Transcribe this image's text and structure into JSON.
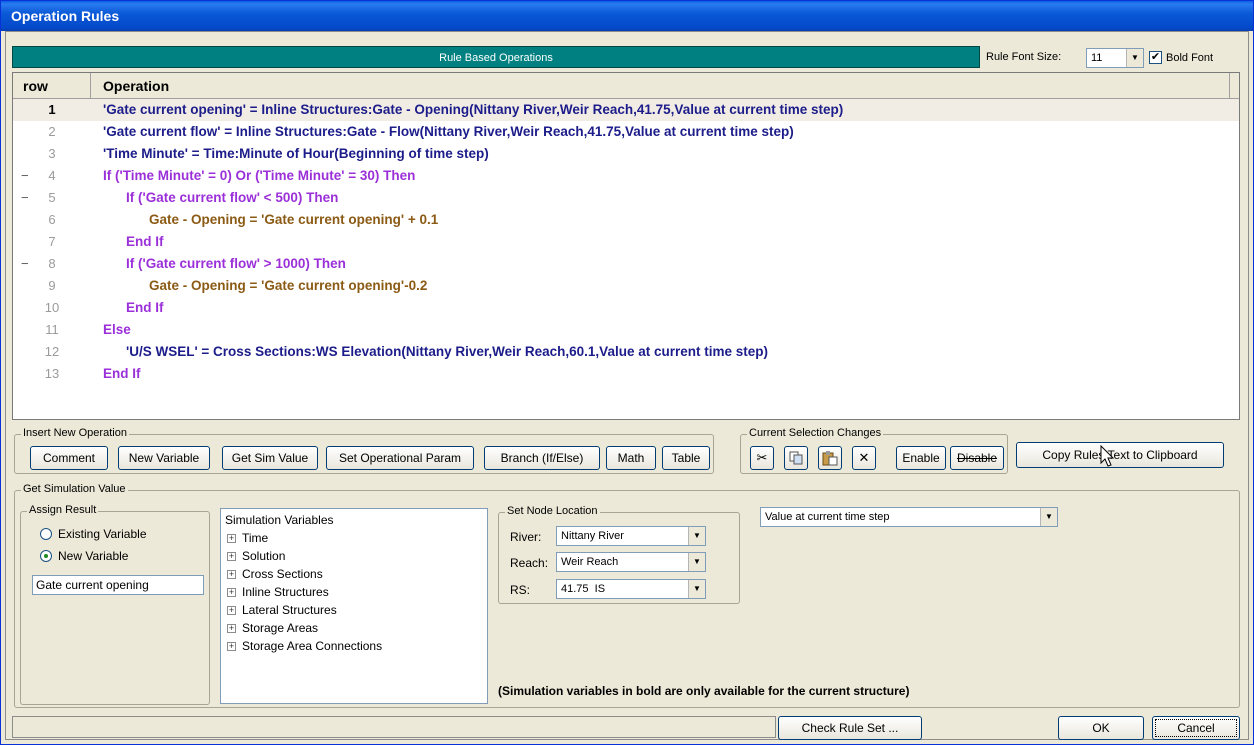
{
  "window": {
    "title": "Operation Rules"
  },
  "header": {
    "band_label": "Rule Based Operations",
    "font_size_label": "Rule Font Size:",
    "font_size_value": "11",
    "bold_font_label": "Bold Font",
    "bold_font_checked": true
  },
  "grid": {
    "col_row": "row",
    "col_op": "Operation",
    "rows": [
      {
        "num": "1",
        "indent": 0,
        "collapse": "",
        "color": "navy",
        "text": "'Gate current opening' = Inline Structures:Gate - Opening(Nittany River,Weir Reach,41.75,Value at current time step)"
      },
      {
        "num": "2",
        "indent": 0,
        "collapse": "",
        "color": "navy",
        "text": "'Gate current flow' = Inline Structures:Gate - Flow(Nittany River,Weir Reach,41.75,Value at current time step)"
      },
      {
        "num": "3",
        "indent": 0,
        "collapse": "",
        "color": "navy",
        "text": "'Time Minute' = Time:Minute of Hour(Beginning of time step)"
      },
      {
        "num": "4",
        "indent": 0,
        "collapse": "−",
        "color": "purple",
        "text": "If ('Time Minute' = 0) Or ('Time Minute' = 30) Then"
      },
      {
        "num": "5",
        "indent": 1,
        "collapse": "−",
        "color": "purple",
        "text": "If ('Gate current flow' < 500) Then"
      },
      {
        "num": "6",
        "indent": 2,
        "collapse": "",
        "color": "brown",
        "text": "Gate - Opening = 'Gate current opening' + 0.1"
      },
      {
        "num": "7",
        "indent": 1,
        "collapse": "",
        "color": "purple",
        "text": "End If"
      },
      {
        "num": "8",
        "indent": 1,
        "collapse": "−",
        "color": "purple",
        "text": "If ('Gate current flow' > 1000) Then"
      },
      {
        "num": "9",
        "indent": 2,
        "collapse": "",
        "color": "brown",
        "text": "Gate - Opening = 'Gate current opening'-0.2"
      },
      {
        "num": "10",
        "indent": 1,
        "collapse": "",
        "color": "purple",
        "text": "End If"
      },
      {
        "num": "11",
        "indent": 0,
        "collapse": "",
        "color": "purple",
        "text": "Else"
      },
      {
        "num": "12",
        "indent": 1,
        "collapse": "",
        "color": "navy",
        "text": "'U/S WSEL' = Cross Sections:WS Elevation(Nittany River,Weir Reach,60.1,Value at current time step)"
      },
      {
        "num": "13",
        "indent": 0,
        "collapse": "",
        "color": "purple",
        "text": "End If"
      }
    ]
  },
  "insert": {
    "label": "Insert New Operation",
    "comment": "Comment",
    "new_variable": "New Variable",
    "get_sim_value": "Get Sim Value",
    "set_op_param": "Set Operational Param",
    "branch": "Branch (If/Else)",
    "math": "Math",
    "table": "Table"
  },
  "selection": {
    "label": "Current Selection Changes",
    "enable": "Enable",
    "disable": "Disable",
    "icons": [
      "cut-icon",
      "copy-icon",
      "paste-icon",
      "delete-icon"
    ]
  },
  "copy_button": "Copy Rules Text to Clipboard",
  "get_sim": {
    "label": "Get Simulation Value",
    "assign": {
      "label": "Assign Result",
      "existing": "Existing Variable",
      "new": "New Variable",
      "selected": "new",
      "name_value": "Gate current opening"
    },
    "tree": {
      "root": "Simulation Variables",
      "items": [
        "Time",
        "Solution",
        "Cross Sections",
        "Inline Structures",
        "Lateral Structures",
        "Storage Areas",
        "Storage Area Connections"
      ]
    },
    "node": {
      "label": "Set Node Location",
      "river_label": "River:",
      "river": "Nittany River",
      "reach_label": "Reach:",
      "reach": "Weir Reach",
      "rs_label": "RS:",
      "rs": "41.75  IS"
    },
    "time_option": "Value at current time step",
    "note": "(Simulation variables in bold are only available for the current structure)"
  },
  "footer": {
    "check": "Check Rule Set ...",
    "ok": "OK",
    "cancel": "Cancel"
  }
}
